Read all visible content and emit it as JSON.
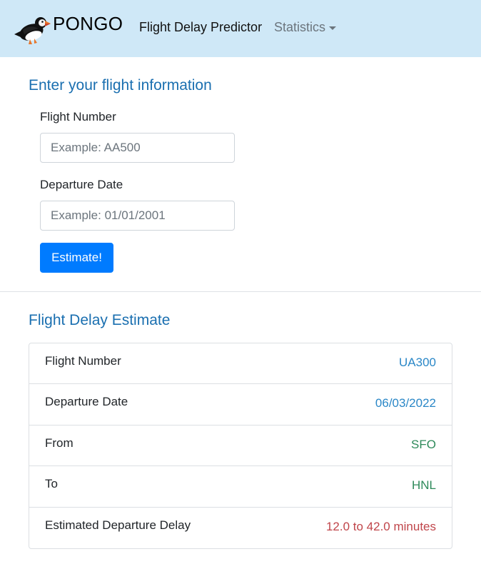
{
  "navbar": {
    "brand_name": "PONGO",
    "home_link": "Flight Delay Predictor",
    "statistics_menu": "Statistics"
  },
  "form": {
    "title": "Enter your flight information",
    "flight_number_label": "Flight Number",
    "flight_number_placeholder": "Example: AA500",
    "flight_number_value": "",
    "departure_date_label": "Departure Date",
    "departure_date_placeholder": "Example: 01/01/2001",
    "departure_date_value": "",
    "submit_label": "Estimate!"
  },
  "result": {
    "title": "Flight Delay Estimate",
    "rows": [
      {
        "label": "Flight Number",
        "value": "UA300"
      },
      {
        "label": "Departure Date",
        "value": "06/03/2022"
      },
      {
        "label": "From",
        "value": "SFO"
      },
      {
        "label": "To",
        "value": "HNL"
      },
      {
        "label": "Estimated Departure Delay",
        "value": "12.0 to 42.0 minutes"
      }
    ]
  },
  "colors": {
    "navbar_bg": "#cfe8f7",
    "heading": "#1a6fb0",
    "primary_button": "#007bff",
    "value_blue": "#2a87c7",
    "value_green": "#2e8a5a",
    "value_red": "#c0454a"
  },
  "icons": {
    "brand_logo": "puffin-logo-icon",
    "dropdown": "caret-down-icon"
  }
}
